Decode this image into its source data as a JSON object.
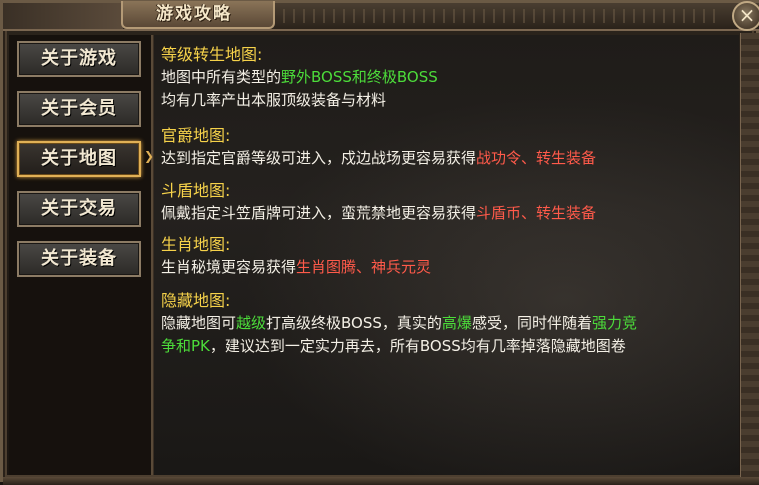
{
  "window": {
    "title": "游戏攻略",
    "close_glyph": "×"
  },
  "sidebar": {
    "items": [
      {
        "label": "关于游戏",
        "active": false
      },
      {
        "label": "关于会员",
        "active": false
      },
      {
        "label": "关于地图",
        "active": true
      },
      {
        "label": "关于交易",
        "active": false
      },
      {
        "label": "关于装备",
        "active": false
      }
    ]
  },
  "colors": {
    "heading": "#f6d24a",
    "body_text": "#f4f0e6",
    "highlight_green": "#4cdc3a",
    "highlight_red": "#ff5a4a"
  },
  "content": {
    "s1": {
      "heading": "等级转生地图:",
      "l1_a": "地图中所有类型的",
      "l1_b": "野外BOSS和终极BOSS",
      "l2": "均有几率产出本服顶级装备与材料"
    },
    "s2": {
      "heading": "官爵地图:",
      "l1_a": "达到指定官爵等级可进入，戍边战场更容易获得",
      "l1_b": "战功令、转生装备"
    },
    "s3": {
      "heading": "斗盾地图:",
      "l1_a": "佩戴指定斗笠盾牌可进入，蛮荒禁地更容易获得",
      "l1_b": "斗盾币、转生装备"
    },
    "s4": {
      "heading": "生肖地图:",
      "l1_a": "生肖秘境更容易获得",
      "l1_b": "生肖图腾、神兵元灵"
    },
    "s5": {
      "heading": "隐藏地图:",
      "l1_a": "隐藏地图可",
      "l1_b": "越级",
      "l1_c": "打高级终极BOSS，真实的",
      "l1_d": "高爆",
      "l1_e": "感受，同时伴随着",
      "l1_f": "强力竞",
      "l2_a": "争和PK",
      "l2_b": "，建议达到一定实力再去，所有BOSS均有几率掉落隐藏地图卷"
    }
  }
}
